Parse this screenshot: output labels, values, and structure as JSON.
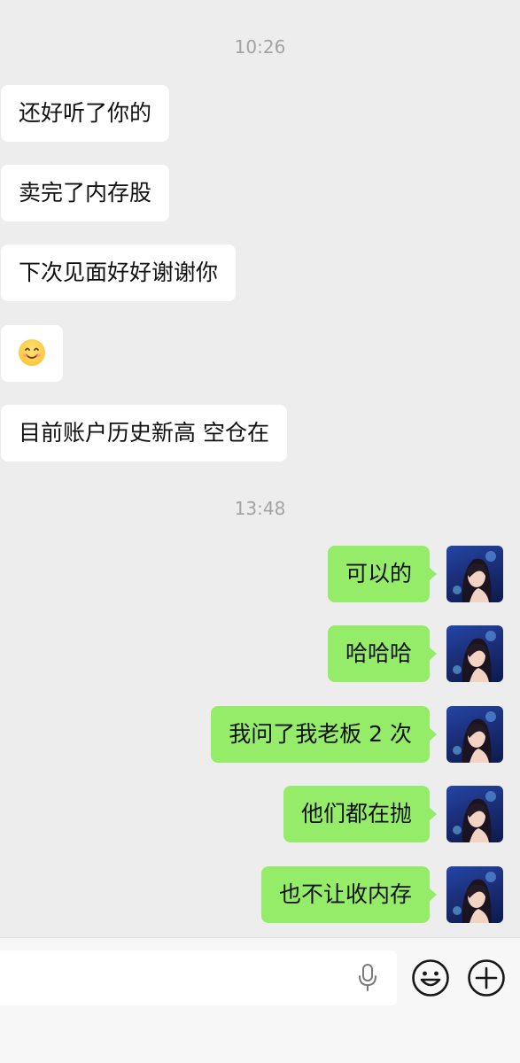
{
  "chat": {
    "timestamps": [
      "10:26",
      "13:48"
    ],
    "incoming": [
      {
        "text": "还好听了你的"
      },
      {
        "text": "卖完了内存股"
      },
      {
        "text": "下次见面好好谢谢你"
      },
      {
        "emoji": "smiling-face-emoji"
      },
      {
        "text": "目前账户历史新高 空仓在"
      }
    ],
    "outgoing": [
      {
        "text": "可以的"
      },
      {
        "text": "哈哈哈"
      },
      {
        "text": "我问了我老板 2 次"
      },
      {
        "text": "他们都在抛"
      },
      {
        "text": "也不让收内存"
      }
    ]
  },
  "input": {
    "value": "",
    "placeholder": ""
  },
  "icons": {
    "voice": "microphone-icon",
    "emoji": "emoji-icon",
    "more": "plus-icon"
  },
  "colors": {
    "background": "#ededed",
    "incoming_bubble": "#ffffff",
    "outgoing_bubble": "#95ec69",
    "timestamp": "#a3a3a3"
  }
}
